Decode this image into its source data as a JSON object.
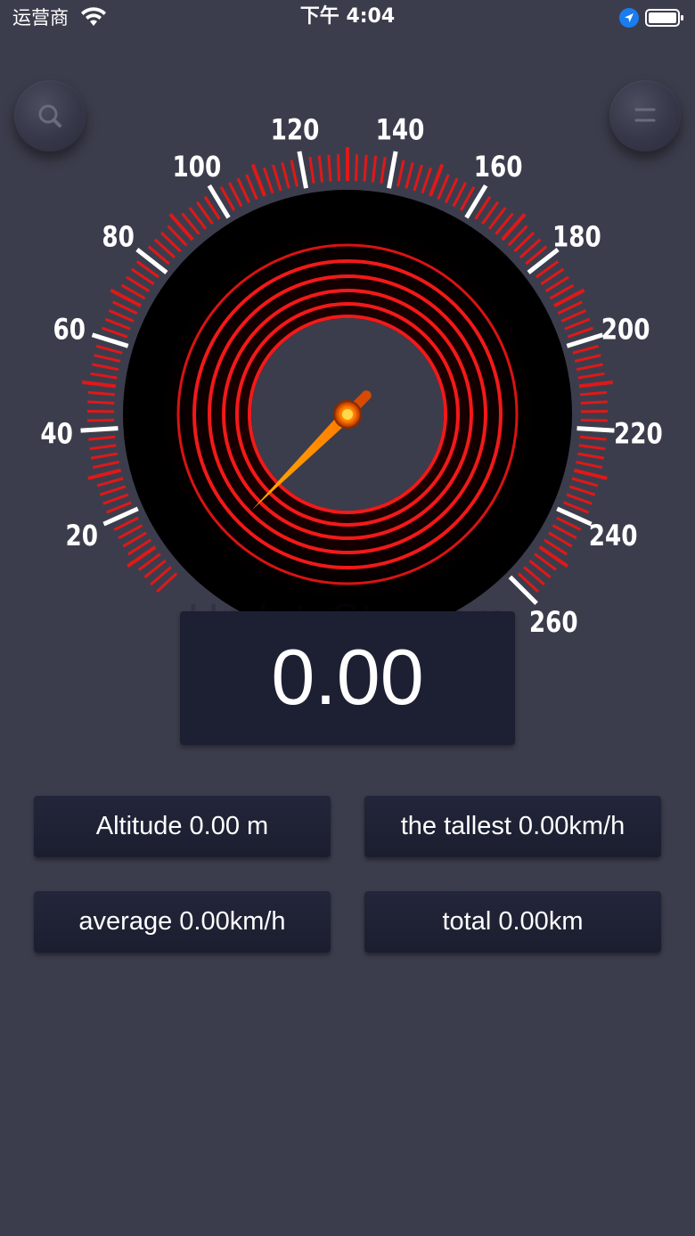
{
  "status_bar": {
    "carrier": "运营商",
    "time": "下午 4:04",
    "icons": [
      "wifi-icon",
      "location-arrow-icon",
      "battery-icon"
    ]
  },
  "toolbar": {
    "left_icon": "search-icon",
    "right_icon": "menu-icon"
  },
  "gauge": {
    "min": 0,
    "max": 260,
    "labels": [
      20,
      40,
      60,
      80,
      100,
      120,
      140,
      160,
      180,
      200,
      "220",
      240,
      260
    ],
    "current_value": 0,
    "scale_color": "#e01818",
    "needle_color": "#ff8c00"
  },
  "watermark": "UpdateStar.com",
  "speed": {
    "value": "0.00"
  },
  "stats": {
    "altitude": "Altitude 0.00 m",
    "tallest": "the tallest 0.00km/h",
    "average": "average 0.00km/h",
    "total": "total 0.00km"
  }
}
